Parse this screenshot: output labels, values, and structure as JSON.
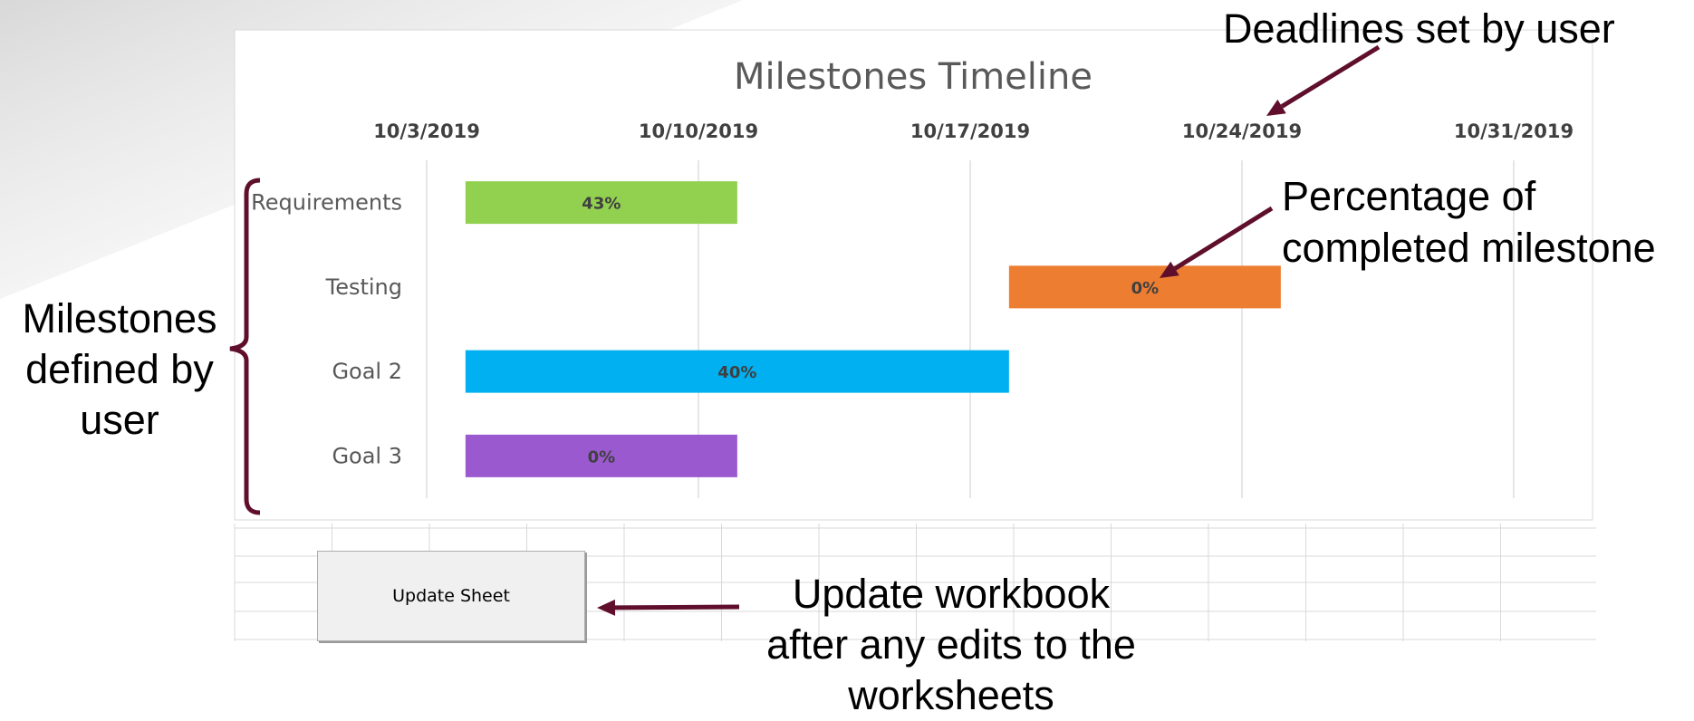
{
  "colors": {
    "accent": "#5f0f2c",
    "gridline": "#d9d9d9",
    "title_text": "#595959",
    "axis_text": "#404040"
  },
  "annotations": {
    "deadlines": "Deadlines set by user",
    "percentage": [
      "Percentage of",
      "completed milestone"
    ],
    "milestones": [
      "Milestones",
      "defined by",
      "user"
    ],
    "update": [
      "Update workbook",
      "after any edits to the",
      "worksheets"
    ]
  },
  "update_button": {
    "label": "Update Sheet"
  },
  "chart_data": {
    "type": "bar",
    "orientation": "horizontal-gantt",
    "title": "Milestones Timeline",
    "x_axis": {
      "type": "date",
      "position": "top",
      "min": "2019-10-03",
      "max": "2019-10-31",
      "ticks": [
        "10/3/2019",
        "10/10/2019",
        "10/17/2019",
        "10/24/2019",
        "10/31/2019"
      ]
    },
    "grid": true,
    "legend": "none",
    "categories": [
      "Requirements",
      "Testing",
      "Goal 2",
      "Goal 3"
    ],
    "bars": [
      {
        "category": "Requirements",
        "start": "2019-10-04",
        "end": "2019-10-11",
        "label": "43%",
        "percent": 43,
        "color": "#92d050"
      },
      {
        "category": "Testing",
        "start": "2019-10-18",
        "end": "2019-10-25",
        "label": "0%",
        "percent": 0,
        "color": "#ed7d31"
      },
      {
        "category": "Goal 2",
        "start": "2019-10-04",
        "end": "2019-10-18",
        "label": "40%",
        "percent": 40,
        "color": "#00b0f0"
      },
      {
        "category": "Goal 3",
        "start": "2019-10-04",
        "end": "2019-10-11",
        "label": "0%",
        "percent": 0,
        "color": "#9b59d0"
      }
    ]
  }
}
